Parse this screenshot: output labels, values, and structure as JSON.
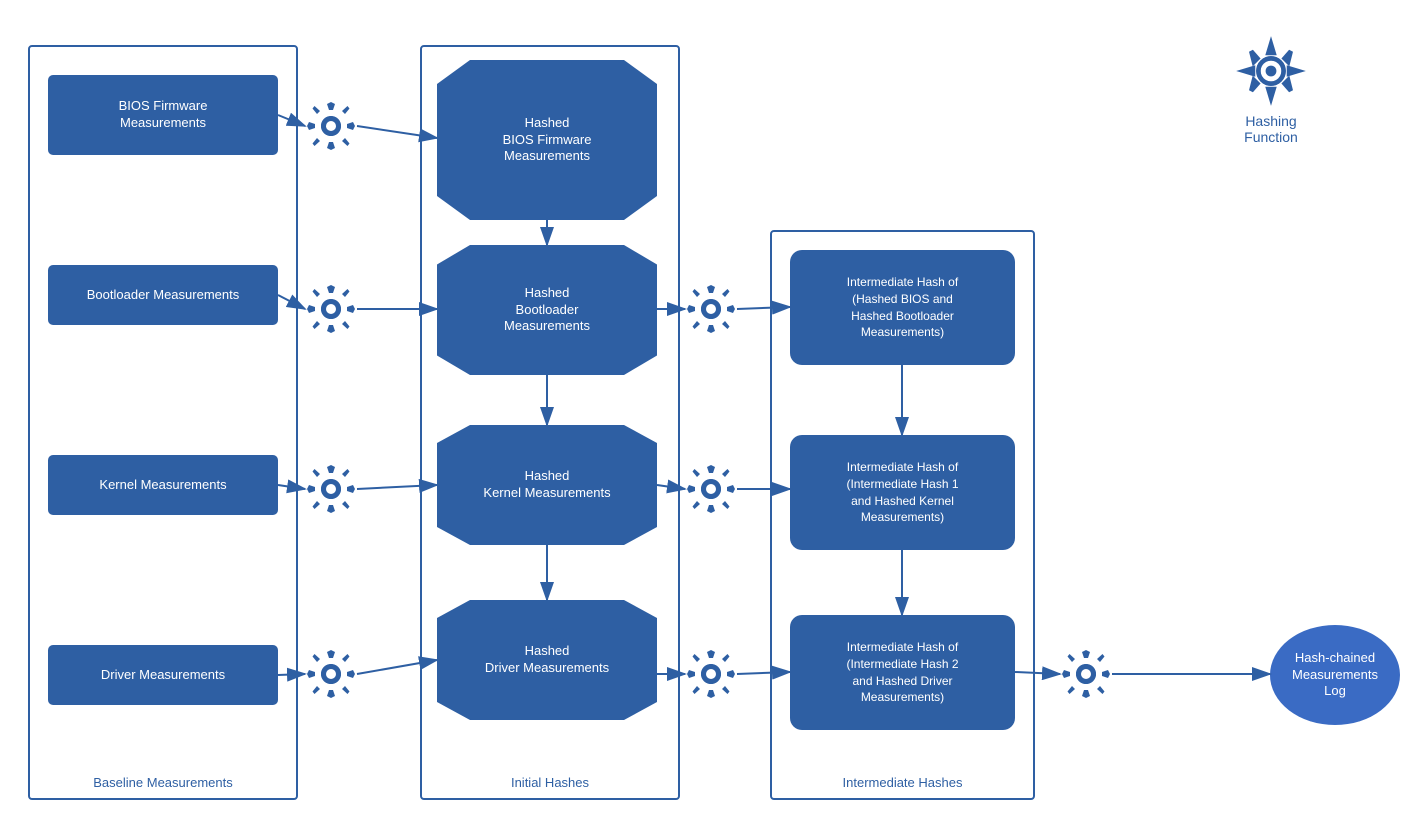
{
  "sections": {
    "baseline": {
      "label": "Baseline Measurements"
    },
    "initial": {
      "label": "Initial Hashes"
    },
    "intermediate": {
      "label": "Intermediate Hashes"
    }
  },
  "baseline_items": [
    {
      "id": "bios",
      "text": "BIOS Firmware\nMeasurements"
    },
    {
      "id": "bootloader",
      "text": "Bootloader Measurements"
    },
    {
      "id": "kernel",
      "text": "Kernel Measurements"
    },
    {
      "id": "driver",
      "text": "Driver Measurements"
    }
  ],
  "initial_hashes": [
    {
      "id": "hashed-bios",
      "text": "Hashed\nBIOS Firmware\nMeasurements"
    },
    {
      "id": "hashed-bootloader",
      "text": "Hashed\nBootloader\nMeasurements"
    },
    {
      "id": "hashed-kernel",
      "text": "Hashed\nKernel Measurements"
    },
    {
      "id": "hashed-driver",
      "text": "Hashed\nDriver Measurements"
    }
  ],
  "intermediate_boxes": [
    {
      "id": "inter1",
      "text": "Intermediate Hash of\n(Hashed BIOS and\nHashed Bootloader\nMeasurements)"
    },
    {
      "id": "inter2",
      "text": "Intermediate Hash of\n(Intermediate Hash 1\nand Hashed Kernel\nMeasurements)"
    },
    {
      "id": "inter3",
      "text": "Intermediate Hash of\n(Intermediate Hash 2\nand Hashed Driver\nMeasurements)"
    }
  ],
  "final": {
    "text": "Hash-chained\nMeasurements Log"
  },
  "hashing_function": {
    "label": "Hashing\nFunction"
  },
  "colors": {
    "blue": "#2e5fa3",
    "light_blue": "#3a6bc4",
    "border": "#2e5fa3"
  }
}
